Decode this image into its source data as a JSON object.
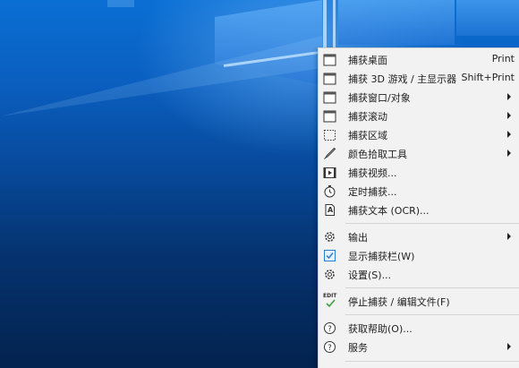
{
  "menu": {
    "items": [
      {
        "label": "捕获桌面",
        "shortcut": "Print",
        "icon": "screen-icon",
        "submenu": false
      },
      {
        "label": "捕获 3D 游戏 / 主显示器",
        "shortcut": "Shift+Print",
        "icon": "screen-icon",
        "submenu": false
      },
      {
        "label": "捕获窗口/对象",
        "shortcut": "",
        "icon": "window-icon",
        "submenu": true
      },
      {
        "label": "捕获滚动",
        "shortcut": "",
        "icon": "window-icon",
        "submenu": true
      },
      {
        "label": "捕获区域",
        "shortcut": "",
        "icon": "region-icon",
        "submenu": true
      },
      {
        "label": "颜色拾取工具",
        "shortcut": "",
        "icon": "eyedropper-icon",
        "submenu": true
      },
      {
        "label": "捕获视频...",
        "shortcut": "",
        "icon": "film-icon",
        "submenu": false
      },
      {
        "label": "定时捕获...",
        "shortcut": "",
        "icon": "timer-icon",
        "submenu": false
      },
      {
        "label": "捕获文本 (OCR)...",
        "shortcut": "",
        "icon": "ocr-icon",
        "submenu": false
      },
      {
        "label": "输出",
        "shortcut": "",
        "icon": "gear-icon",
        "submenu": true
      },
      {
        "label": "显示捕获栏(W)",
        "shortcut": "",
        "icon": "checkbox-icon",
        "submenu": false
      },
      {
        "label": "设置(S)...",
        "shortcut": "",
        "icon": "gear-icon",
        "submenu": false
      },
      {
        "label": "停止捕获 / 编辑文件(F)",
        "shortcut": "",
        "icon": "edit-icon",
        "submenu": false
      },
      {
        "label": "获取帮助(O)...",
        "shortcut": "",
        "icon": "help-icon",
        "submenu": false
      },
      {
        "label": "服务",
        "shortcut": "",
        "icon": "help-icon",
        "submenu": true
      }
    ],
    "edit_icon_text": "EDIT",
    "ocr_icon_text": "A"
  },
  "colors": {
    "menu_bg": "#f2f2f2",
    "checkbox_accent": "#2a7fd0",
    "edit_check": "#3aa03a"
  }
}
